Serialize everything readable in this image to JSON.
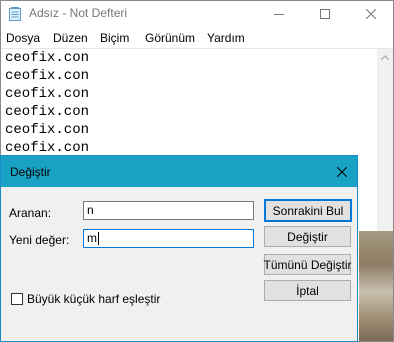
{
  "window": {
    "title": "Adsız - Not Defteri",
    "controls": [
      "minimize",
      "maximize",
      "close"
    ]
  },
  "menu": {
    "items": [
      "Dosya",
      "Düzen",
      "Biçim",
      "Görünüm",
      "Yardım"
    ]
  },
  "editor": {
    "lines": [
      "ceofix.con",
      "ceofix.con",
      "ceofix.con",
      "ceofix.con",
      "ceofix.con",
      "ceofix.con"
    ]
  },
  "dialog": {
    "title": "Değiştir",
    "find_label": "Aranan:",
    "find_value": "n",
    "replace_label": "Yeni değer:",
    "replace_value": "m",
    "match_case_label": "Büyük küçük harf eşleştir",
    "match_case_checked": false,
    "buttons": {
      "find_next": "Sonrakini Bul",
      "replace": "Değiştir",
      "replace_all": "Tümünü Değiştir",
      "cancel": "İptal"
    }
  },
  "colors": {
    "dialog_titlebar": "#1aa2c4",
    "dialog_background": "#f0f0f0",
    "focus_border": "#0078d7"
  }
}
